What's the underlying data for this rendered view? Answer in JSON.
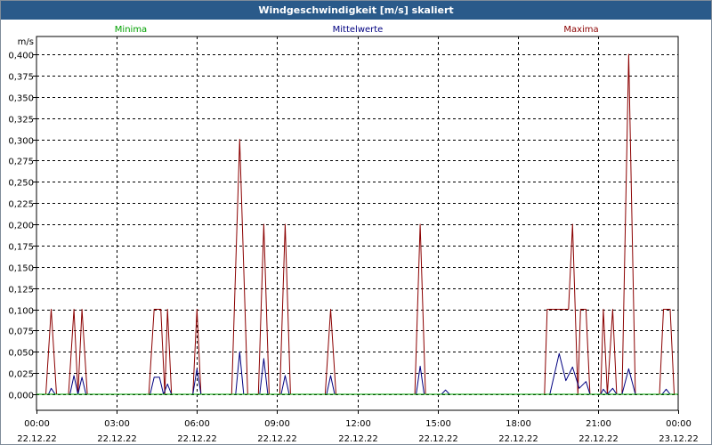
{
  "window": {
    "title": "Windgeschwindigkeit [m/s] skaliert"
  },
  "legend": [
    {
      "label": "Minima",
      "color": "#00a000"
    },
    {
      "label": "Mittelwerte",
      "color": "#000080"
    },
    {
      "label": "Maxima",
      "color": "#8b0000"
    }
  ],
  "chart_data": {
    "type": "line",
    "title": "Windgeschwindigkeit [m/s] skaliert",
    "ylabel": "m/s",
    "xlabel": "",
    "ylim": [
      -0.01,
      0.42
    ],
    "xlim_hours": [
      0,
      24
    ],
    "grid": true,
    "y_ticks": [
      "0,000",
      "0,025",
      "0,050",
      "0,075",
      "0,100",
      "0,125",
      "0,150",
      "0,175",
      "0,200",
      "0,225",
      "0,250",
      "0,275",
      "0,300",
      "0,325",
      "0,350",
      "0,375",
      "0,400"
    ],
    "y_tick_values": [
      0,
      0.025,
      0.05,
      0.075,
      0.1,
      0.125,
      0.15,
      0.175,
      0.2,
      0.225,
      0.25,
      0.275,
      0.3,
      0.325,
      0.35,
      0.375,
      0.4
    ],
    "x_ticks": [
      {
        "time": "00:00",
        "date": "22.12.22",
        "hour": 0
      },
      {
        "time": "03:00",
        "date": "22.12.22",
        "hour": 3
      },
      {
        "time": "06:00",
        "date": "22.12.22",
        "hour": 6
      },
      {
        "time": "09:00",
        "date": "22.12.22",
        "hour": 9
      },
      {
        "time": "12:00",
        "date": "22.12.22",
        "hour": 12
      },
      {
        "time": "15:00",
        "date": "22.12.22",
        "hour": 15
      },
      {
        "time": "18:00",
        "date": "22.12.22",
        "hour": 18
      },
      {
        "time": "21:00",
        "date": "22.12.22",
        "hour": 21
      },
      {
        "time": "00:00",
        "date": "23.12.22",
        "hour": 24
      }
    ],
    "series": [
      {
        "name": "Maxima",
        "color": "#8b0000",
        "points": [
          [
            0,
            0
          ],
          [
            0.35,
            0
          ],
          [
            0.55,
            0.1
          ],
          [
            0.75,
            0
          ],
          [
            1.2,
            0
          ],
          [
            1.4,
            0.1
          ],
          [
            1.55,
            0
          ],
          [
            1.7,
            0.1
          ],
          [
            1.9,
            0
          ],
          [
            4.2,
            0
          ],
          [
            4.4,
            0.1
          ],
          [
            4.65,
            0.1
          ],
          [
            4.8,
            0
          ],
          [
            4.9,
            0.1
          ],
          [
            5.05,
            0
          ],
          [
            5.85,
            0
          ],
          [
            6.0,
            0.1
          ],
          [
            6.15,
            0
          ],
          [
            7.3,
            0
          ],
          [
            7.6,
            0.3
          ],
          [
            7.9,
            0
          ],
          [
            8.3,
            0
          ],
          [
            8.5,
            0.2
          ],
          [
            8.7,
            0
          ],
          [
            9.1,
            0
          ],
          [
            9.3,
            0.2
          ],
          [
            9.5,
            0
          ],
          [
            10.8,
            0
          ],
          [
            11.0,
            0.1
          ],
          [
            11.2,
            0
          ],
          [
            14.15,
            0
          ],
          [
            14.35,
            0.2
          ],
          [
            14.55,
            0
          ],
          [
            19.0,
            0
          ],
          [
            19.1,
            0.1
          ],
          [
            19.9,
            0.1
          ],
          [
            20.05,
            0.2
          ],
          [
            20.25,
            0
          ],
          [
            20.35,
            0.1
          ],
          [
            20.55,
            0.1
          ],
          [
            20.7,
            0
          ],
          [
            21.1,
            0
          ],
          [
            21.2,
            0.1
          ],
          [
            21.35,
            0
          ],
          [
            21.55,
            0.1
          ],
          [
            21.7,
            0
          ],
          [
            21.9,
            0
          ],
          [
            22.15,
            0.4
          ],
          [
            22.4,
            0
          ],
          [
            23.3,
            0
          ],
          [
            23.45,
            0.1
          ],
          [
            23.7,
            0.1
          ],
          [
            23.85,
            0
          ],
          [
            24,
            0
          ]
        ]
      },
      {
        "name": "Mittelwerte",
        "color": "#000080",
        "points": [
          [
            0,
            0
          ],
          [
            0.45,
            0
          ],
          [
            0.55,
            0.007
          ],
          [
            0.7,
            0
          ],
          [
            1.25,
            0
          ],
          [
            1.4,
            0.022
          ],
          [
            1.55,
            0
          ],
          [
            1.7,
            0.02
          ],
          [
            1.85,
            0
          ],
          [
            4.25,
            0
          ],
          [
            4.4,
            0.02
          ],
          [
            4.6,
            0.02
          ],
          [
            4.75,
            0
          ],
          [
            4.9,
            0.012
          ],
          [
            5.05,
            0
          ],
          [
            5.85,
            0
          ],
          [
            6.0,
            0.03
          ],
          [
            6.15,
            0
          ],
          [
            7.45,
            0
          ],
          [
            7.6,
            0.05
          ],
          [
            7.75,
            0
          ],
          [
            8.35,
            0
          ],
          [
            8.5,
            0.042
          ],
          [
            8.65,
            0
          ],
          [
            9.15,
            0
          ],
          [
            9.3,
            0.022
          ],
          [
            9.45,
            0
          ],
          [
            10.85,
            0
          ],
          [
            11.0,
            0.022
          ],
          [
            11.15,
            0
          ],
          [
            14.2,
            0
          ],
          [
            14.35,
            0.033
          ],
          [
            14.5,
            0
          ],
          [
            15.15,
            0
          ],
          [
            15.3,
            0.005
          ],
          [
            15.45,
            0
          ],
          [
            19.2,
            0
          ],
          [
            19.55,
            0.048
          ],
          [
            19.8,
            0.016
          ],
          [
            20.05,
            0.032
          ],
          [
            20.3,
            0.007
          ],
          [
            20.55,
            0.015
          ],
          [
            20.7,
            0
          ],
          [
            21.1,
            0
          ],
          [
            21.2,
            0.006
          ],
          [
            21.35,
            0
          ],
          [
            21.55,
            0.007
          ],
          [
            21.7,
            0
          ],
          [
            21.9,
            0
          ],
          [
            22.15,
            0.03
          ],
          [
            22.4,
            0
          ],
          [
            23.4,
            0
          ],
          [
            23.55,
            0.006
          ],
          [
            23.7,
            0
          ],
          [
            24,
            0
          ]
        ]
      },
      {
        "name": "Minima",
        "color": "#00a000",
        "points": [
          [
            0,
            0
          ],
          [
            24,
            0
          ]
        ]
      }
    ]
  }
}
